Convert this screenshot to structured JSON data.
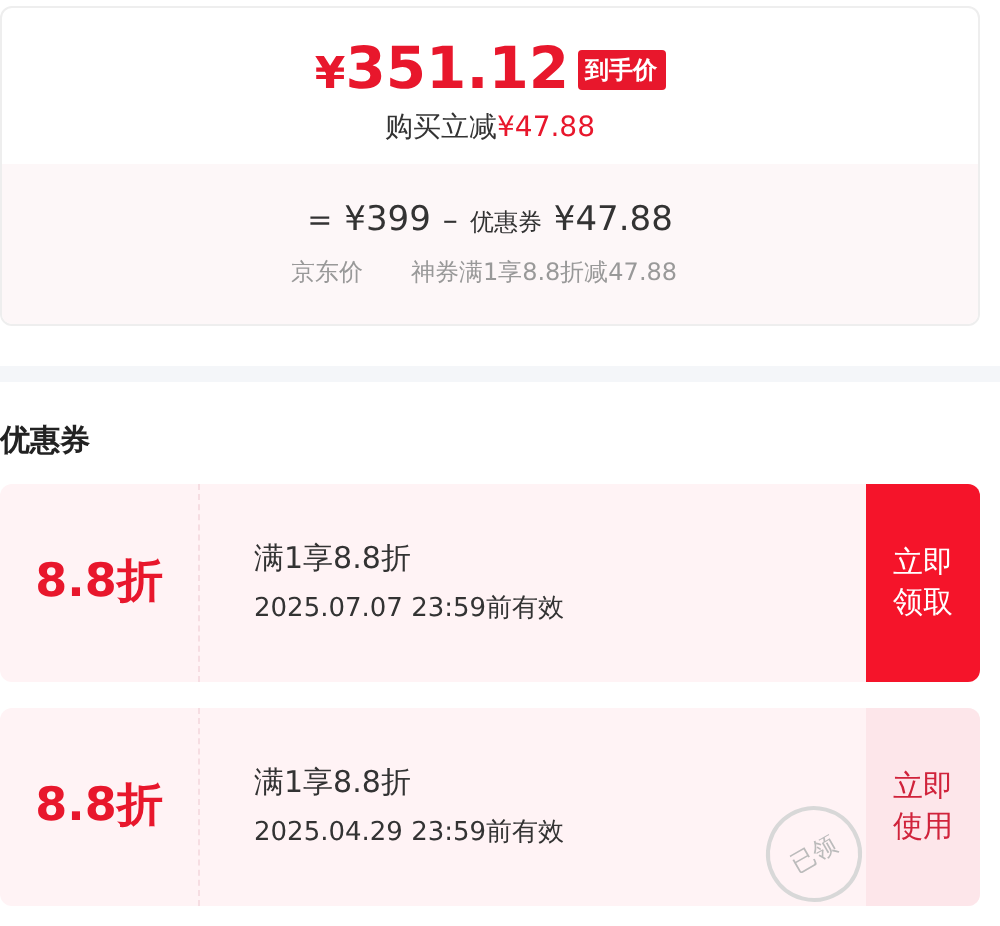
{
  "price_card": {
    "currency": "¥",
    "final_price": "351.12",
    "final_tag": "到手价",
    "saving_label": "购买立减",
    "saving_amount": "¥47.88",
    "formula": {
      "equals": "=",
      "base_price": "¥399",
      "minus": "–",
      "coupon_label": "优惠券",
      "coupon_amount": "¥47.88",
      "base_caption": "京东价",
      "coupon_caption": "神券满1享8.8折减47.88"
    }
  },
  "coupons_section": {
    "title": "优惠券",
    "coupons": [
      {
        "discount": "8.8折",
        "condition": "满1享8.8折",
        "validity": "2025.07.07 23:59前有效",
        "action": "立即领取",
        "claimed": false
      },
      {
        "discount": "8.8折",
        "condition": "满1享8.8折",
        "validity": "2025.04.29 23:59前有效",
        "action": "立即使用",
        "claimed": true,
        "stamp": "已领"
      }
    ]
  }
}
